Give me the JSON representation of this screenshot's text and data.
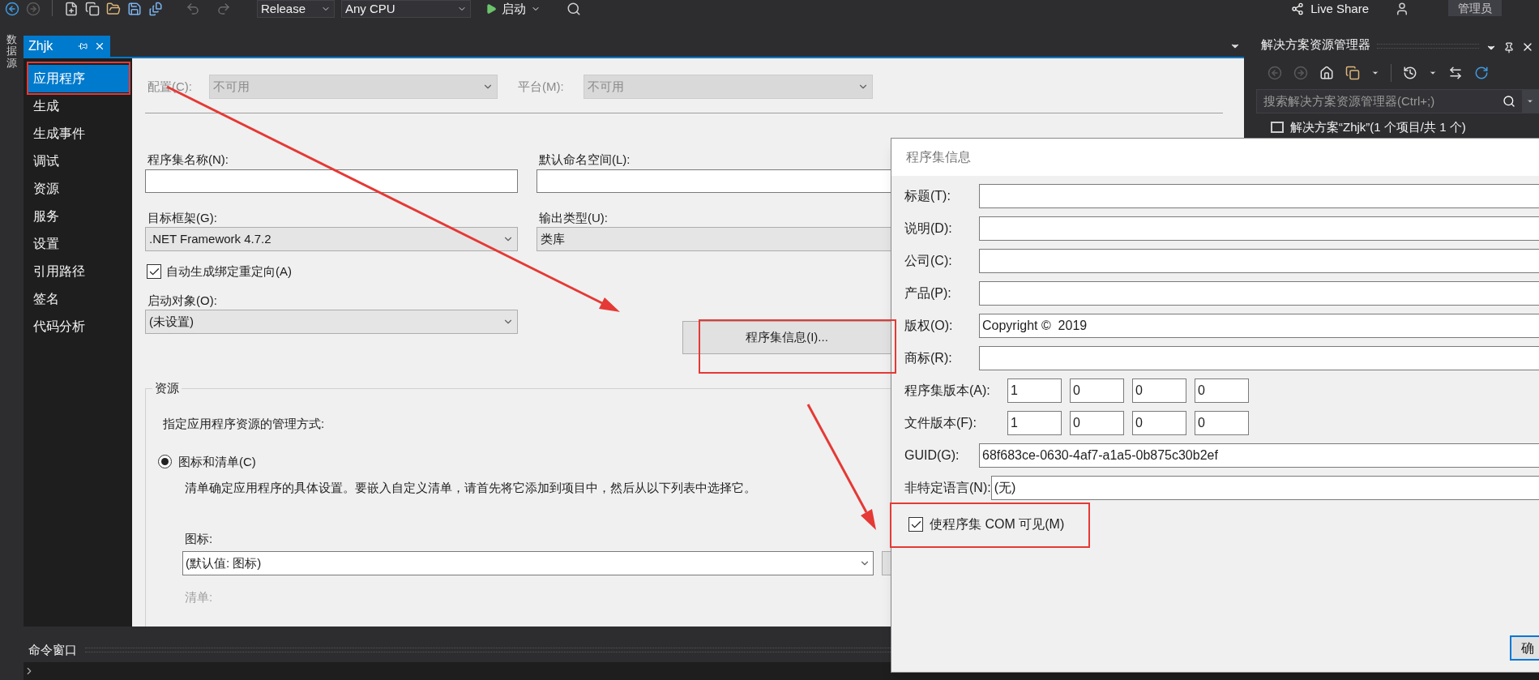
{
  "toolbar": {
    "configuration": "Release",
    "platform": "Any CPU",
    "start_button": "启动",
    "live_share": "Live Share",
    "account": "管理员"
  },
  "side_strip": {
    "label": "数据源"
  },
  "document_tab": {
    "title": "Zhjk"
  },
  "nav": [
    {
      "label": "应用程序",
      "selected": true
    },
    {
      "label": "生成",
      "selected": false
    },
    {
      "label": "生成事件",
      "selected": false
    },
    {
      "label": "调试",
      "selected": false
    },
    {
      "label": "资源",
      "selected": false
    },
    {
      "label": "服务",
      "selected": false
    },
    {
      "label": "设置",
      "selected": false
    },
    {
      "label": "引用路径",
      "selected": false
    },
    {
      "label": "签名",
      "selected": false
    },
    {
      "label": "代码分析",
      "selected": false
    }
  ],
  "page": {
    "configuration": {
      "label": "配置(C):",
      "value": "不可用",
      "disabled": true
    },
    "platform": {
      "label": "平台(M):",
      "value": "不可用",
      "disabled": true
    },
    "assembly_name": {
      "label": "程序集名称(N):"
    },
    "default_namespace": {
      "label": "默认命名空间(L):"
    },
    "target_framework": {
      "label": "目标框架(G):",
      "value": ".NET Framework 4.7.2"
    },
    "output_type": {
      "label": "输出类型(U):",
      "value": "类库"
    },
    "auto_binding_redirect": {
      "label": "自动生成绑定重定向(A)",
      "checked": true
    },
    "startup_object": {
      "label": "启动对象(O):",
      "value": "(未设置)"
    },
    "assembly_info_button": "程序集信息(I)...",
    "resources": {
      "title": "资源",
      "hint": "指定应用程序资源的管理方式:",
      "options": [
        {
          "label": "图标和清单(C)",
          "selected": true
        }
      ],
      "description": "清单确定应用程序的具体设置。要嵌入自定义清单，请首先将它添加到项目中，然后从以下列表中选择它。",
      "icon": {
        "label": "图标:",
        "value": "(默认值: 图标)"
      },
      "manifest": {
        "label": "清单:",
        "disabled": true
      }
    }
  },
  "solution_explorer": {
    "title": "解决方案资源管理器",
    "search": {
      "placeholder": "搜索解决方案资源管理器(Ctrl+;)"
    },
    "tree": [
      {
        "label": "解决方案“Zhjk”(1 个项目/共 1 个)"
      }
    ]
  },
  "command_window": {
    "title": "命令窗口"
  },
  "dialog": {
    "title": "程序集信息",
    "fields": [
      {
        "kind": "text",
        "label": "标题(T):"
      },
      {
        "kind": "text",
        "label": "说明(D):"
      },
      {
        "kind": "text",
        "label": "公司(C):"
      },
      {
        "kind": "text",
        "label": "产品(P):"
      },
      {
        "kind": "text",
        "label": "版权(O):",
        "value": "Copyright ©  2019"
      },
      {
        "kind": "text",
        "label": "商标(R):"
      },
      {
        "kind": "version",
        "label": "程序集版本(A):",
        "parts": [
          "1",
          "0",
          "0",
          "0"
        ]
      },
      {
        "kind": "version",
        "label": "文件版本(F):",
        "parts": [
          "1",
          "0",
          "0",
          "0"
        ]
      },
      {
        "kind": "text",
        "label": "GUID(G):",
        "value": "68f683ce-0630-4af7-a1a5-0b875c30b2ef"
      },
      {
        "kind": "text",
        "label": "非特定语言(N):",
        "value": "(无)"
      }
    ],
    "com_visible": {
      "label": "使程序集 COM 可见(M)",
      "checked": true
    },
    "ok_button": "确"
  }
}
